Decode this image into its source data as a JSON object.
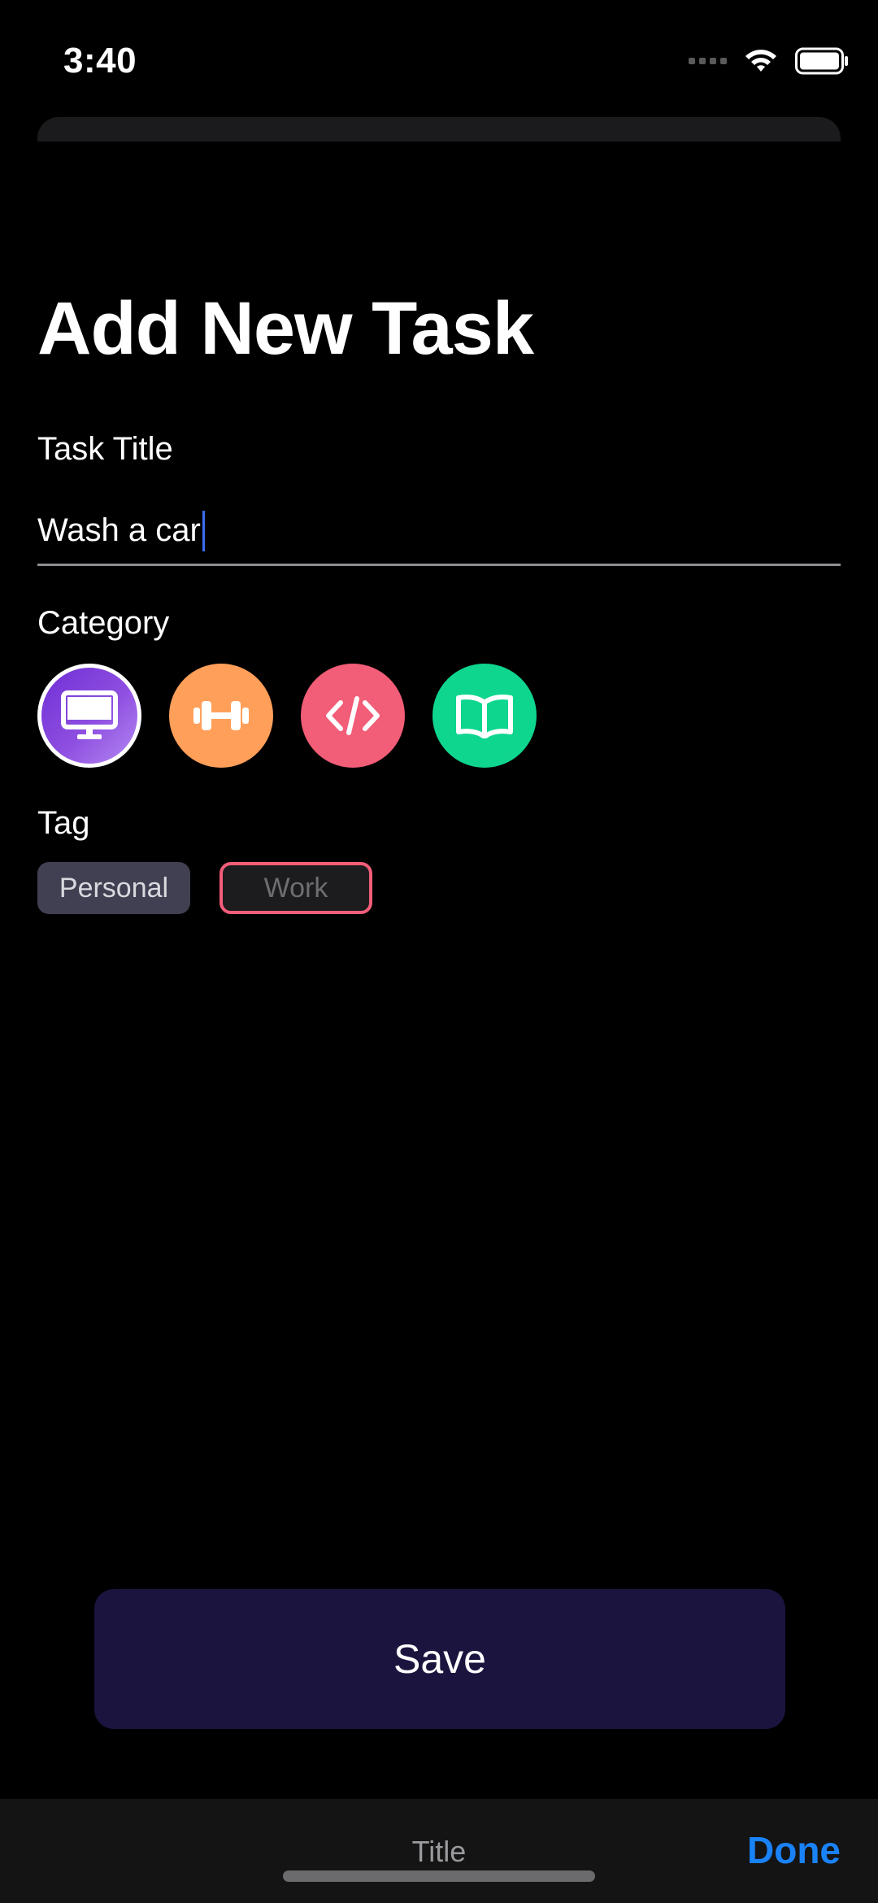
{
  "status_bar": {
    "time": "3:40"
  },
  "page": {
    "title": "Add New Task"
  },
  "task_title": {
    "label": "Task Title",
    "value": "Wash a car"
  },
  "category": {
    "label": "Category",
    "options": [
      {
        "icon": "monitor-icon",
        "color": "#8e4ee0",
        "selected": true
      },
      {
        "icon": "dumbbell-icon",
        "color": "#ff9f5a",
        "selected": false
      },
      {
        "icon": "code-icon",
        "color": "#f25d77",
        "selected": false
      },
      {
        "icon": "book-icon",
        "color": "#0ed68f",
        "selected": false
      }
    ]
  },
  "tag": {
    "label": "Tag",
    "options": [
      {
        "label": "Personal",
        "selected": false
      },
      {
        "label": "Work",
        "selected": true,
        "accent": "#f25d77"
      }
    ]
  },
  "save": {
    "label": "Save",
    "color": "#1b143e"
  },
  "keyboard_toolbar": {
    "title": "Title",
    "done": "Done",
    "done_color": "#1a82f7"
  }
}
